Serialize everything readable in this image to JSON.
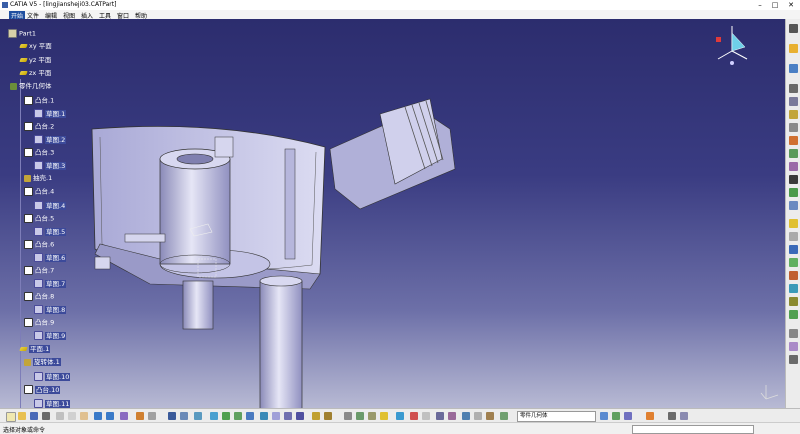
{
  "window": {
    "title": "CATIA V5 - [lingjiansheji03.CATPart]",
    "min": "–",
    "max": "□",
    "close": "✕"
  },
  "menu": {
    "start": "开始",
    "items": [
      "文件",
      "编辑",
      "视图",
      "插入",
      "工具",
      "窗口",
      "帮助"
    ]
  },
  "tree": {
    "root": "Part1",
    "nodes": [
      {
        "label": "xy 平面",
        "icon": "plane-icon",
        "sel": false
      },
      {
        "label": "yz 平面",
        "icon": "plane-icon",
        "sel": false
      },
      {
        "label": "zx 平面",
        "icon": "plane-icon",
        "sel": false
      },
      {
        "label": "零件几何体",
        "icon": "body-icon",
        "sel": false
      },
      {
        "label": "凸台.1",
        "icon": "pad-icon",
        "sel": false
      },
      {
        "label": "草图.1",
        "icon": "sketch-icon",
        "sel": true
      },
      {
        "label": "凸台.2",
        "icon": "pad-icon",
        "sel": false
      },
      {
        "label": "草图.2",
        "icon": "sketch-icon",
        "sel": true
      },
      {
        "label": "凸台.3",
        "icon": "pad-icon",
        "sel": false
      },
      {
        "label": "草图.3",
        "icon": "sketch-icon",
        "sel": true
      },
      {
        "label": "抽壳.1",
        "icon": "shell-icon",
        "sel": false
      },
      {
        "label": "凸台.4",
        "icon": "pad-icon",
        "sel": false
      },
      {
        "label": "草图.4",
        "icon": "sketch-icon",
        "sel": true
      },
      {
        "label": "凸台.5",
        "icon": "pad-icon",
        "sel": false
      },
      {
        "label": "草图.5",
        "icon": "sketch-icon",
        "sel": true
      },
      {
        "label": "凸台.6",
        "icon": "pad-icon",
        "sel": false
      },
      {
        "label": "草图.6",
        "icon": "sketch-icon",
        "sel": true
      },
      {
        "label": "凸台.7",
        "icon": "pad-icon",
        "sel": false
      },
      {
        "label": "草图.7",
        "icon": "sketch-icon",
        "sel": true
      },
      {
        "label": "凸台.8",
        "icon": "pad-icon",
        "sel": false
      },
      {
        "label": "草图.8",
        "icon": "sketch-icon",
        "sel": true
      },
      {
        "label": "凸台.9",
        "icon": "pad-icon",
        "sel": false
      },
      {
        "label": "草图.9",
        "icon": "sketch-icon",
        "sel": true
      },
      {
        "label": "平面.1",
        "icon": "plane-icon",
        "sel": true
      },
      {
        "label": "旋转体.1",
        "icon": "shaft-icon",
        "sel": true
      },
      {
        "label": "草图.10",
        "icon": "sketch-icon",
        "sel": true
      },
      {
        "label": "凸台.10",
        "icon": "pad-icon",
        "sel": true
      },
      {
        "label": "草图.11",
        "icon": "sketch-icon",
        "sel": true
      }
    ]
  },
  "toolbar": {
    "body_select": "零件几何体"
  },
  "status": {
    "prompt": "选择对象或命令"
  },
  "colors": {
    "bg_top": "#2c2d6e",
    "bg_bottom": "#b8bad4",
    "part": "#c9c9ea",
    "selection": "#3c4a9a"
  }
}
